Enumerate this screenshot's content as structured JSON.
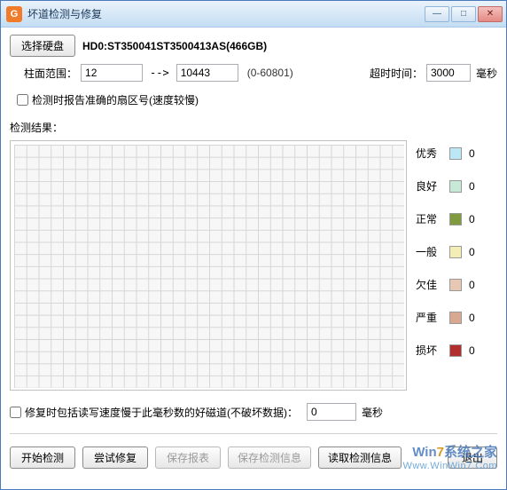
{
  "titlebar": {
    "app_icon_letter": "G",
    "title": "坏道检测与修复"
  },
  "disk": {
    "select_button": "选择硬盘",
    "label": "HD0:ST350041ST3500413AS(466GB)"
  },
  "range": {
    "label": "柱面范围：",
    "from": "12",
    "arrow": "-->",
    "to": "10443",
    "hint": "(0-60801)"
  },
  "timeout": {
    "label": "超时时间：",
    "value": "3000",
    "unit": "毫秒"
  },
  "options": {
    "accurate_sector": "检测时报告准确的扇区号(速度较慢)"
  },
  "result": {
    "label": "检测结果："
  },
  "legend": {
    "excellent": {
      "label": "优秀",
      "count": "0"
    },
    "good": {
      "label": "良好",
      "count": "0"
    },
    "normal": {
      "label": "正常",
      "count": "0"
    },
    "average": {
      "label": "一般",
      "count": "0"
    },
    "poor": {
      "label": "欠佳",
      "count": "0"
    },
    "severe": {
      "label": "严重",
      "count": "0"
    },
    "damage": {
      "label": "损坏",
      "count": "0"
    }
  },
  "repair": {
    "include_slow_label": "修复时包括读写速度慢于此毫秒数的好磁道(不破坏数据)：",
    "threshold": "0",
    "unit": "毫秒"
  },
  "buttons": {
    "start": "开始检测",
    "try_repair": "尝试修复",
    "save_report": "保存报表",
    "save_info": "保存检测信息",
    "read_info": "读取检测信息",
    "exit": "退出"
  },
  "watermark": {
    "line1_a": "Win",
    "line1_b": "7",
    "line1_c": "系统之家",
    "line2": "Www.WinWin7.Com"
  }
}
